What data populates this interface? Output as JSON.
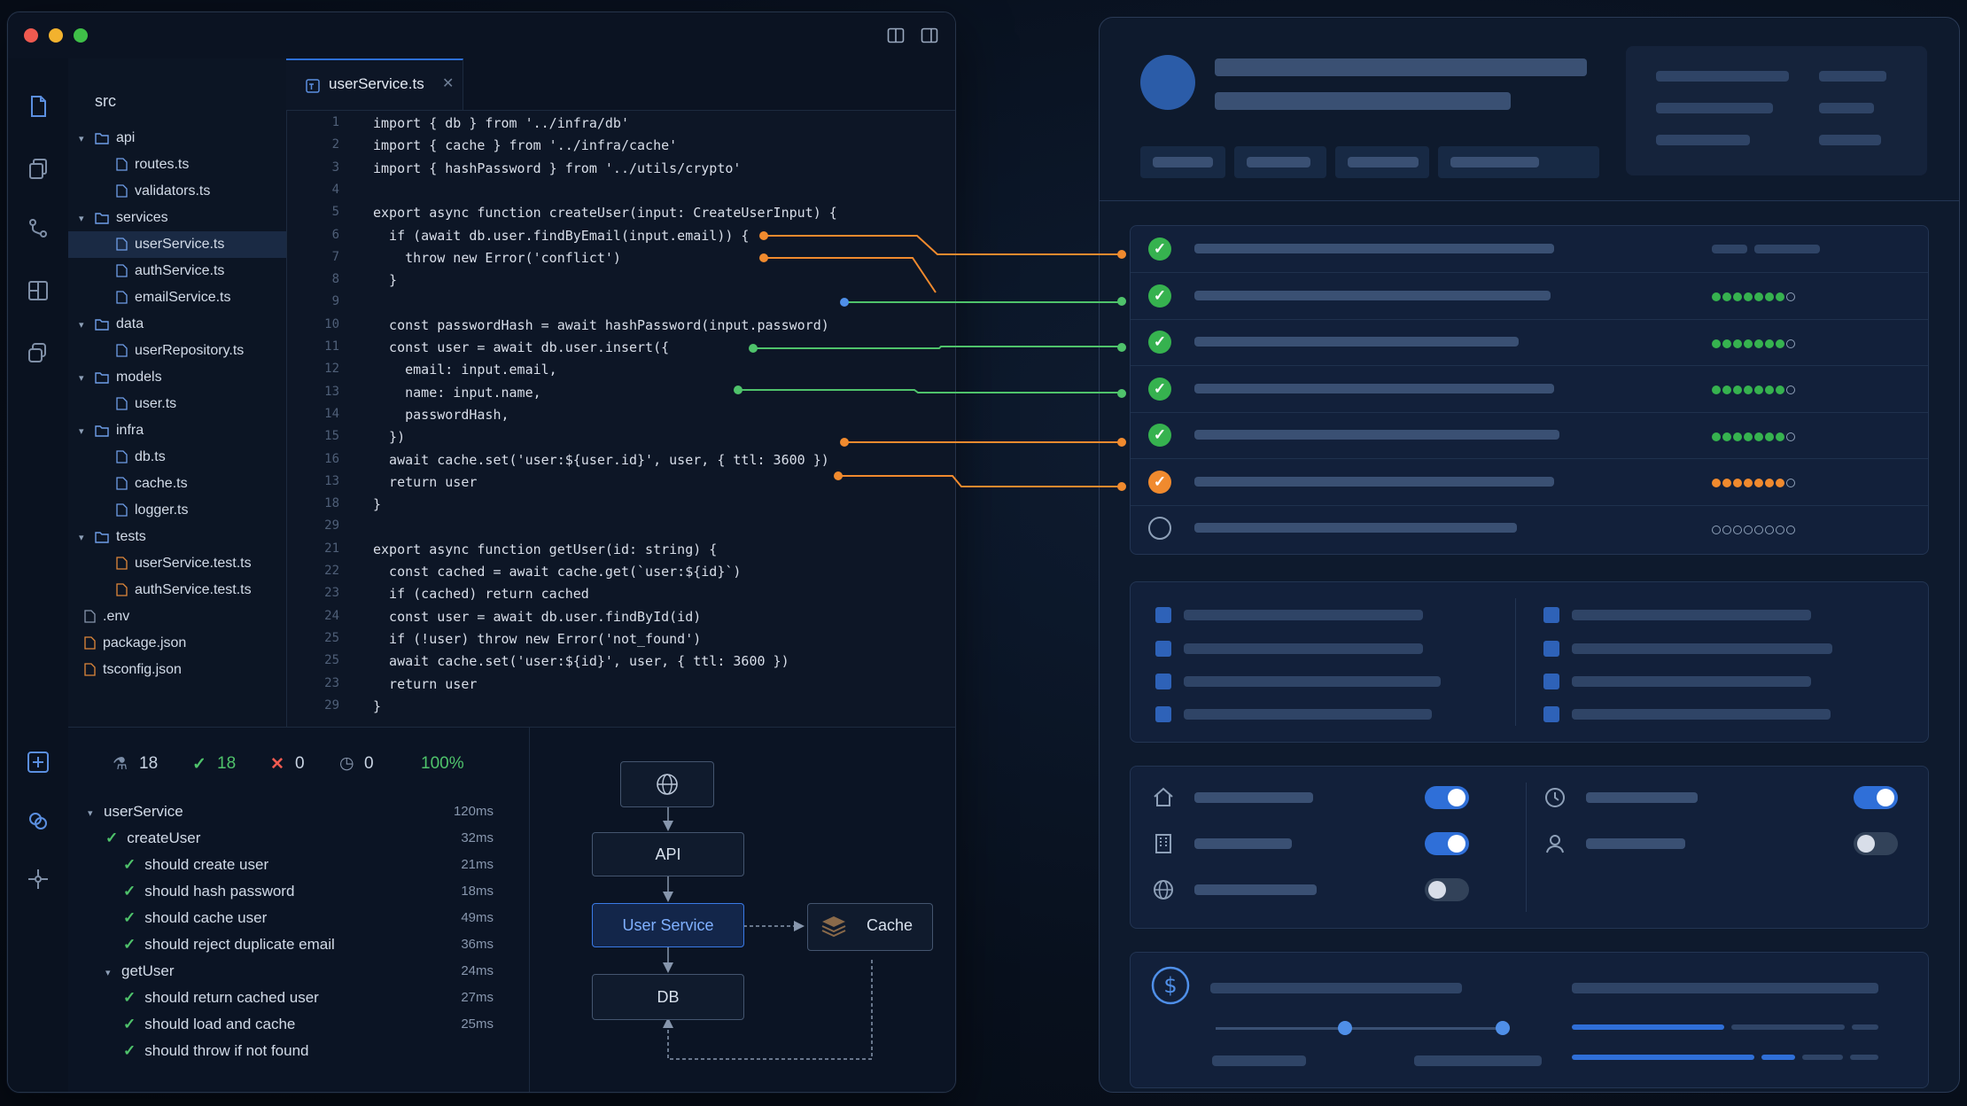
{
  "explorer": {
    "root": "src",
    "items": [
      {
        "label": "api",
        "kind": "folder",
        "depth": 1
      },
      {
        "label": "routes.ts",
        "kind": "file",
        "depth": 2
      },
      {
        "label": "validators.ts",
        "kind": "file",
        "depth": 2
      },
      {
        "label": "services",
        "kind": "folder",
        "depth": 1
      },
      {
        "label": "userService.ts",
        "kind": "file",
        "depth": 2,
        "selected": true
      },
      {
        "label": "authService.ts",
        "kind": "file",
        "depth": 2
      },
      {
        "label": "emailService.ts",
        "kind": "file",
        "depth": 2
      },
      {
        "label": "data",
        "kind": "folder",
        "depth": 1
      },
      {
        "label": "userRepository.ts",
        "kind": "file",
        "depth": 2
      },
      {
        "label": "models",
        "kind": "folder",
        "depth": 1
      },
      {
        "label": "user.ts",
        "kind": "file",
        "depth": 2
      },
      {
        "label": "infra",
        "kind": "folder",
        "depth": 1
      },
      {
        "label": "db.ts",
        "kind": "file",
        "depth": 2
      },
      {
        "label": "cache.ts",
        "kind": "file",
        "depth": 2
      },
      {
        "label": "logger.ts",
        "kind": "file",
        "depth": 2
      },
      {
        "label": "tests",
        "kind": "folder",
        "depth": 1
      },
      {
        "label": "userService.test.ts",
        "kind": "testfile",
        "depth": 2
      },
      {
        "label": "authService.test.ts",
        "kind": "testfile",
        "depth": 2
      },
      {
        "label": ".env",
        "kind": "plain",
        "depth": 1
      },
      {
        "label": "package.json",
        "kind": "json",
        "depth": 1
      },
      {
        "label": "tsconfig.json",
        "kind": "json",
        "depth": 1
      }
    ]
  },
  "editor": {
    "tab_label": "userService.ts",
    "lines": [
      {
        "n": "1",
        "t": "import { db } from '../infra/db'"
      },
      {
        "n": "2",
        "t": "import { cache } from '../infra/cache'"
      },
      {
        "n": "3",
        "t": "import { hashPassword } from '../utils/crypto'"
      },
      {
        "n": "4",
        "t": ""
      },
      {
        "n": "5",
        "t": "export async function createUser(input: CreateUserInput) {"
      },
      {
        "n": "6",
        "t": "  if (await db.user.findByEmail(input.email)) {"
      },
      {
        "n": "7",
        "t": "    throw new Error('conflict')"
      },
      {
        "n": "8",
        "t": "  }"
      },
      {
        "n": "9",
        "t": ""
      },
      {
        "n": "10",
        "t": "  const passwordHash = await hashPassword(input.password)"
      },
      {
        "n": "11",
        "t": "  const user = await db.user.insert({"
      },
      {
        "n": "12",
        "t": "    email: input.email,"
      },
      {
        "n": "13",
        "t": "    name: input.name,"
      },
      {
        "n": "14",
        "t": "    passwordHash,"
      },
      {
        "n": "15",
        "t": "  })"
      },
      {
        "n": "16",
        "t": "  await cache.set('user:${user.id}', user, { ttl: 3600 })"
      },
      {
        "n": "13",
        "t": "  return user"
      },
      {
        "n": "18",
        "t": "}"
      },
      {
        "n": "29",
        "t": ""
      },
      {
        "n": "21",
        "t": "export async function getUser(id: string) {"
      },
      {
        "n": "22",
        "t": "  const cached = await cache.get(`user:${id}`)"
      },
      {
        "n": "23",
        "t": "  if (cached) return cached"
      },
      {
        "n": "24",
        "t": "  const user = await db.user.findById(id)"
      },
      {
        "n": "25",
        "t": "  if (!user) throw new Error('not_found')"
      },
      {
        "n": "25",
        "t": "  await cache.set('user:${id}', user, { ttl: 3600 })"
      },
      {
        "n": "23",
        "t": "  return user"
      },
      {
        "n": "29",
        "t": "}"
      }
    ]
  },
  "test_summary": {
    "total": "18",
    "passed": "18",
    "failed": "0",
    "skipped": "0",
    "coverage": "100%"
  },
  "tests": [
    {
      "label": "userService",
      "time": "120ms",
      "level": 0,
      "type": "suite"
    },
    {
      "label": "createUser",
      "time": "32ms",
      "level": 1,
      "type": "group"
    },
    {
      "label": "should create user",
      "time": "21ms",
      "level": 2,
      "type": "test"
    },
    {
      "label": "should hash password",
      "time": "18ms",
      "level": 2,
      "type": "test"
    },
    {
      "label": "should cache user",
      "time": "49ms",
      "level": 2,
      "type": "test"
    },
    {
      "label": "should reject duplicate email",
      "time": "36ms",
      "level": 2,
      "type": "test"
    },
    {
      "label": "getUser",
      "time": "24ms",
      "level": 1,
      "type": "group"
    },
    {
      "label": "should return cached user",
      "time": "27ms",
      "level": 2,
      "type": "test"
    },
    {
      "label": "should load and cache",
      "time": "25ms",
      "level": 2,
      "type": "test"
    },
    {
      "label": "should throw if not found",
      "time": "",
      "level": 2,
      "type": "test"
    }
  ],
  "diagram": {
    "api": "API",
    "service": "User Service",
    "db": "DB",
    "cache": "Cache"
  },
  "checklist_status": [
    "done",
    "done",
    "done",
    "done",
    "done",
    "warning",
    "pending"
  ],
  "toggles": {
    "left": [
      "on",
      "on",
      "off"
    ],
    "right": [
      "on",
      "off"
    ]
  },
  "slider": {
    "low": 0.45,
    "high": 1.0
  },
  "colors": {
    "accent": "#2f6fd8",
    "success": "#36b24f",
    "warning": "#f08a2e",
    "link_blue": "#4f8fe8"
  },
  "icons": {
    "activity": [
      "files-icon",
      "copy-icon",
      "source-control-icon",
      "extensions-icon",
      "layers-icon",
      "add-panel-icon",
      "debug-icon",
      "sparkle-icon"
    ],
    "settings_left": [
      "home-icon",
      "building-icon",
      "globe-icon"
    ],
    "settings_right": [
      "clock-icon",
      "user-icon"
    ]
  }
}
